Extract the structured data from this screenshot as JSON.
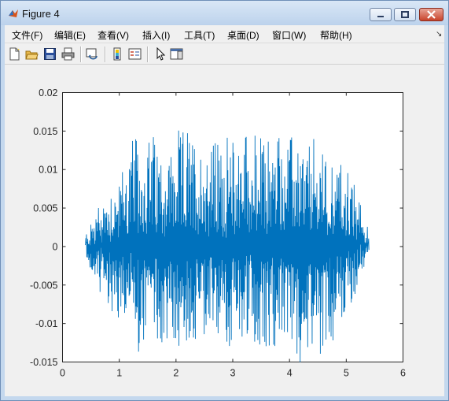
{
  "window": {
    "title": "Figure 4",
    "controls": [
      "minimize",
      "maximize",
      "close"
    ]
  },
  "menu": [
    {
      "label": "文件(F)"
    },
    {
      "label": "编辑(E)"
    },
    {
      "label": "查看(V)"
    },
    {
      "label": "插入(I)"
    },
    {
      "label": "工具(T)"
    },
    {
      "label": "桌面(D)"
    },
    {
      "label": "窗口(W)"
    },
    {
      "label": "帮助(H)"
    }
  ],
  "toolbar": {
    "icons": [
      "new-figure-icon",
      "open-file-icon",
      "save-icon",
      "print-icon",
      "link-plot-icon",
      "colorbar-icon",
      "legend-icon",
      "pointer-icon",
      "property-editor-icon"
    ]
  },
  "colors": {
    "line": "#0072bd",
    "axes_bg": "#ffffff",
    "figure_bg": "#f0f0f0",
    "close_button": "#c8432b"
  },
  "chart_data": {
    "type": "line",
    "description_of_series": "dense oscillating waveform",
    "x_range_data": [
      0.4,
      5.4
    ],
    "xlim": [
      0,
      6
    ],
    "ylim": [
      -0.015,
      0.02
    ],
    "x_ticks": [
      "0",
      "1",
      "2",
      "3",
      "4",
      "5",
      "6"
    ],
    "y_ticks": [
      "-0.015",
      "-0.01",
      "-0.005",
      "0",
      "0.005",
      "0.01",
      "0.015",
      "0.02"
    ],
    "x_tick_values": [
      0,
      1,
      2,
      3,
      4,
      5,
      6
    ],
    "y_tick_values": [
      -0.015,
      -0.01,
      -0.005,
      0,
      0.005,
      0.01,
      0.015,
      0.02
    ],
    "envelope": {
      "x": [
        0.4,
        0.6,
        0.8,
        1.0,
        1.2,
        1.4,
        1.6,
        1.8,
        2.0,
        2.2,
        2.4,
        2.6,
        2.8,
        3.0,
        3.2,
        3.4,
        3.6,
        3.8,
        4.0,
        4.2,
        4.4,
        4.6,
        4.8,
        5.0,
        5.2,
        5.4
      ],
      "max": [
        0.001,
        0.005,
        0.0078,
        0.009,
        0.014,
        0.0135,
        0.015,
        0.0125,
        0.014,
        0.0155,
        0.014,
        0.0145,
        0.0135,
        0.014,
        0.0165,
        0.014,
        0.0145,
        0.0155,
        0.0145,
        0.0135,
        0.0135,
        0.013,
        0.0115,
        0.0105,
        0.007,
        0.001
      ],
      "min": [
        -0.001,
        -0.005,
        -0.008,
        -0.0105,
        -0.0115,
        -0.0145,
        -0.012,
        -0.013,
        -0.0135,
        -0.0125,
        -0.013,
        -0.0115,
        -0.0125,
        -0.0135,
        -0.0125,
        -0.013,
        -0.0145,
        -0.0135,
        -0.0125,
        -0.0145,
        -0.0125,
        -0.0135,
        -0.012,
        -0.0095,
        -0.006,
        -0.001
      ]
    },
    "title": "",
    "xlabel": "",
    "ylabel": "",
    "grid": false,
    "legend": "none"
  }
}
